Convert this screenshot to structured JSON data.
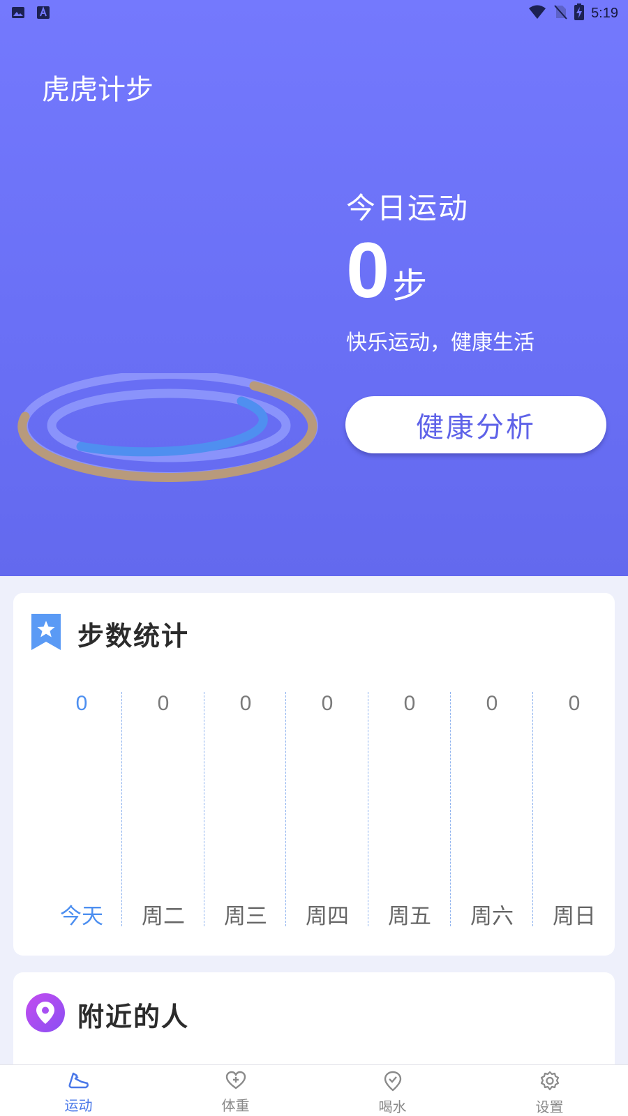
{
  "status_bar": {
    "time": "5:19",
    "left_icons": [
      "image-icon",
      "font-icon"
    ],
    "right_icons": [
      "wifi-icon",
      "no-sim-icon",
      "battery-charging-icon"
    ]
  },
  "app": {
    "title": "虎虎计步"
  },
  "today": {
    "label": "今日运动",
    "steps": "0",
    "unit": "步",
    "slogan": "快乐运动，健康生活",
    "analysis_button": "健康分析"
  },
  "step_stats": {
    "title": "步数统计",
    "icon": "bookmark-star-icon",
    "days": [
      {
        "label": "今天",
        "value": "0",
        "active": true
      },
      {
        "label": "周二",
        "value": "0"
      },
      {
        "label": "周三",
        "value": "0"
      },
      {
        "label": "周四",
        "value": "0"
      },
      {
        "label": "周五",
        "value": "0"
      },
      {
        "label": "周六",
        "value": "0"
      },
      {
        "label": "周日",
        "value": "0"
      }
    ]
  },
  "nearby": {
    "title": "附近的人",
    "icon": "location-pin-icon"
  },
  "bottom_nav": [
    {
      "label": "运动",
      "icon": "sneaker-icon",
      "active": true
    },
    {
      "label": "体重",
      "icon": "heart-plus-icon"
    },
    {
      "label": "喝水",
      "icon": "check-pin-icon"
    },
    {
      "label": "设置",
      "icon": "gear-icon"
    }
  ],
  "colors": {
    "hero_top": "#7479fd",
    "hero_bottom": "#6369ee",
    "accent_blue": "#4d8ff0",
    "ring_gold": "#b89a7c",
    "button_text": "#5e62e8"
  }
}
